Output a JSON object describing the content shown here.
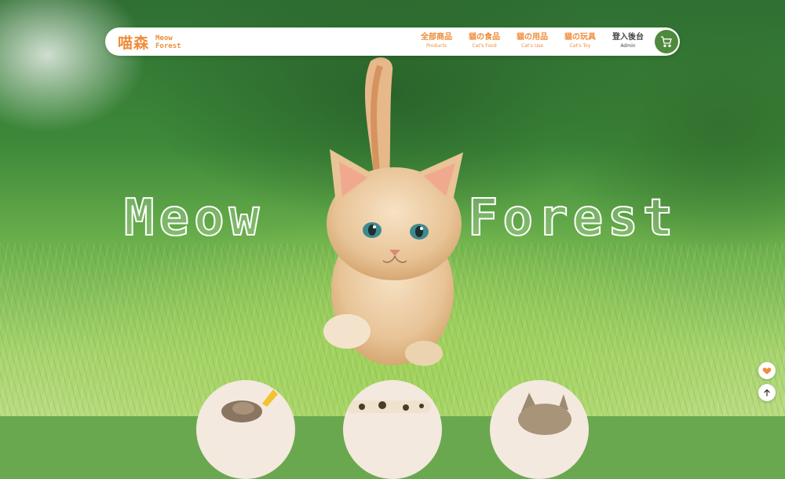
{
  "brand": {
    "name_cn": "喵森",
    "name_en_line1": "Meow",
    "name_en_line2": "Forest",
    "color": "#f08c3a"
  },
  "nav": {
    "items": [
      {
        "label": "全部商品",
        "sub": "Products"
      },
      {
        "label": "貓の食品",
        "sub": "Cat's Food"
      },
      {
        "label": "貓の用品",
        "sub": "Cat's Use"
      },
      {
        "label": "貓の玩具",
        "sub": "Cat's Toy"
      }
    ],
    "admin": {
      "label": "登入後台",
      "sub": "Admin"
    },
    "cart_icon": "shopping-cart-icon"
  },
  "hero": {
    "title_left": "Meow",
    "title_right": "Forest"
  },
  "floating": {
    "like_icon": "heart-icon",
    "top_icon": "arrow-up-icon"
  },
  "colors": {
    "accent": "#f08c3a",
    "cart_bg": "#4e8a3c",
    "heart": "#f08c3a"
  }
}
